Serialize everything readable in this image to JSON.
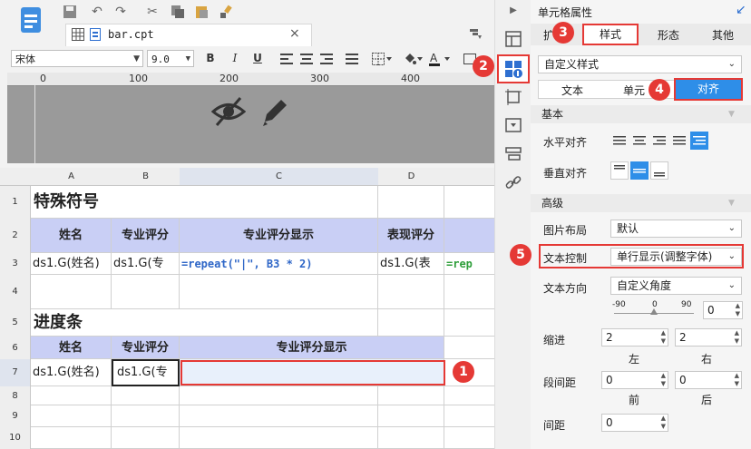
{
  "toolbar": {
    "tab_label": "bar.cpt",
    "font_name": "宋体",
    "font_size": "9.0",
    "bold": "B",
    "italic": "I",
    "underline": "U"
  },
  "ruler": {
    "labels": [
      "0",
      "100",
      "200",
      "300",
      "400"
    ]
  },
  "grid": {
    "columns": [
      "A",
      "B",
      "C",
      "D"
    ],
    "rows": [
      "1",
      "2",
      "3",
      "4",
      "5",
      "6",
      "7",
      "8",
      "9",
      "10"
    ],
    "title1": "特殊符号",
    "headers1": [
      "姓名",
      "专业评分",
      "专业评分显示",
      "表现评分"
    ],
    "row3": [
      "ds1.G(姓名)",
      "ds1.G(专",
      "=repeat(\"|\", B3 * 2)",
      "ds1.G(表",
      "=rep"
    ],
    "title2": "进度条",
    "headers2": [
      "姓名",
      "专业评分",
      "专业评分显示"
    ],
    "row7": [
      "ds1.G(姓名)",
      "ds1.G(专"
    ]
  },
  "panel": {
    "title": "单元格属性",
    "tabs": [
      "扩",
      "样式",
      "形态",
      "其他"
    ],
    "style_select": "自定义样式",
    "subtabs": [
      "文本",
      "单元",
      "对齐"
    ],
    "section_basic": "基本",
    "h_align_label": "水平对齐",
    "v_align_label": "垂直对齐",
    "section_advanced": "高级",
    "image_layout_label": "图片布局",
    "image_layout_value": "默认",
    "text_control_label": "文本控制",
    "text_control_value": "单行显示(调整字体)",
    "text_direction_label": "文本方向",
    "text_direction_value": "自定义角度",
    "angle_ticks": [
      "-90",
      "0",
      "90"
    ],
    "angle_value": "0",
    "indent_label": "缩进",
    "indent_left": "2",
    "indent_right": "2",
    "left_label": "左",
    "right_label": "右",
    "para_label": "段间距",
    "para_before": "0",
    "para_after": "0",
    "before_label": "前",
    "after_label": "后",
    "spacing_label": "间距",
    "spacing_value": "0"
  },
  "callouts": [
    "1",
    "2",
    "3",
    "4",
    "5"
  ],
  "colors": {
    "accent": "#2e8ee8",
    "callout": "#e53935",
    "header_fill": "#c9cff5"
  }
}
